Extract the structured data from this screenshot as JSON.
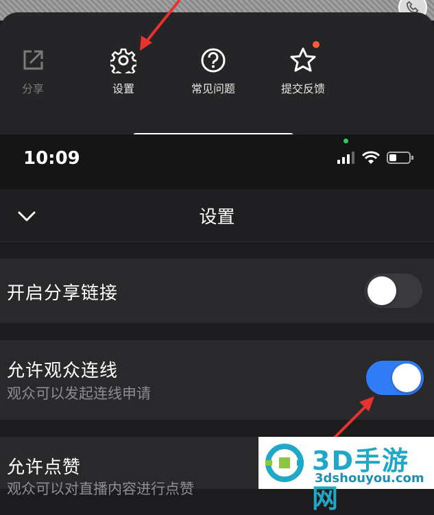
{
  "share_sheet": {
    "items": [
      {
        "label": "分享",
        "icon": "share-icon"
      },
      {
        "label": "设置",
        "icon": "gear-icon"
      },
      {
        "label": "常见问题",
        "icon": "help-icon"
      },
      {
        "label": "提交反馈",
        "icon": "star-icon"
      }
    ]
  },
  "status_bar": {
    "time": "10:09"
  },
  "nav": {
    "title": "设置"
  },
  "settings": [
    {
      "title": "开启分享链接",
      "subtitle": "",
      "enabled": false
    },
    {
      "title": "允许观众连线",
      "subtitle": "观众可以发起连线申请",
      "enabled": true
    },
    {
      "title": "允许点赞",
      "subtitle": "观众可以对直播内容进行点赞",
      "enabled": null
    }
  ],
  "watermark": {
    "main": "3D手游网",
    "sub": "3dshouyou.com"
  },
  "colors": {
    "accent": "#2f7cf6",
    "badge": "#ff5a36",
    "arrow": "#e8322e"
  }
}
